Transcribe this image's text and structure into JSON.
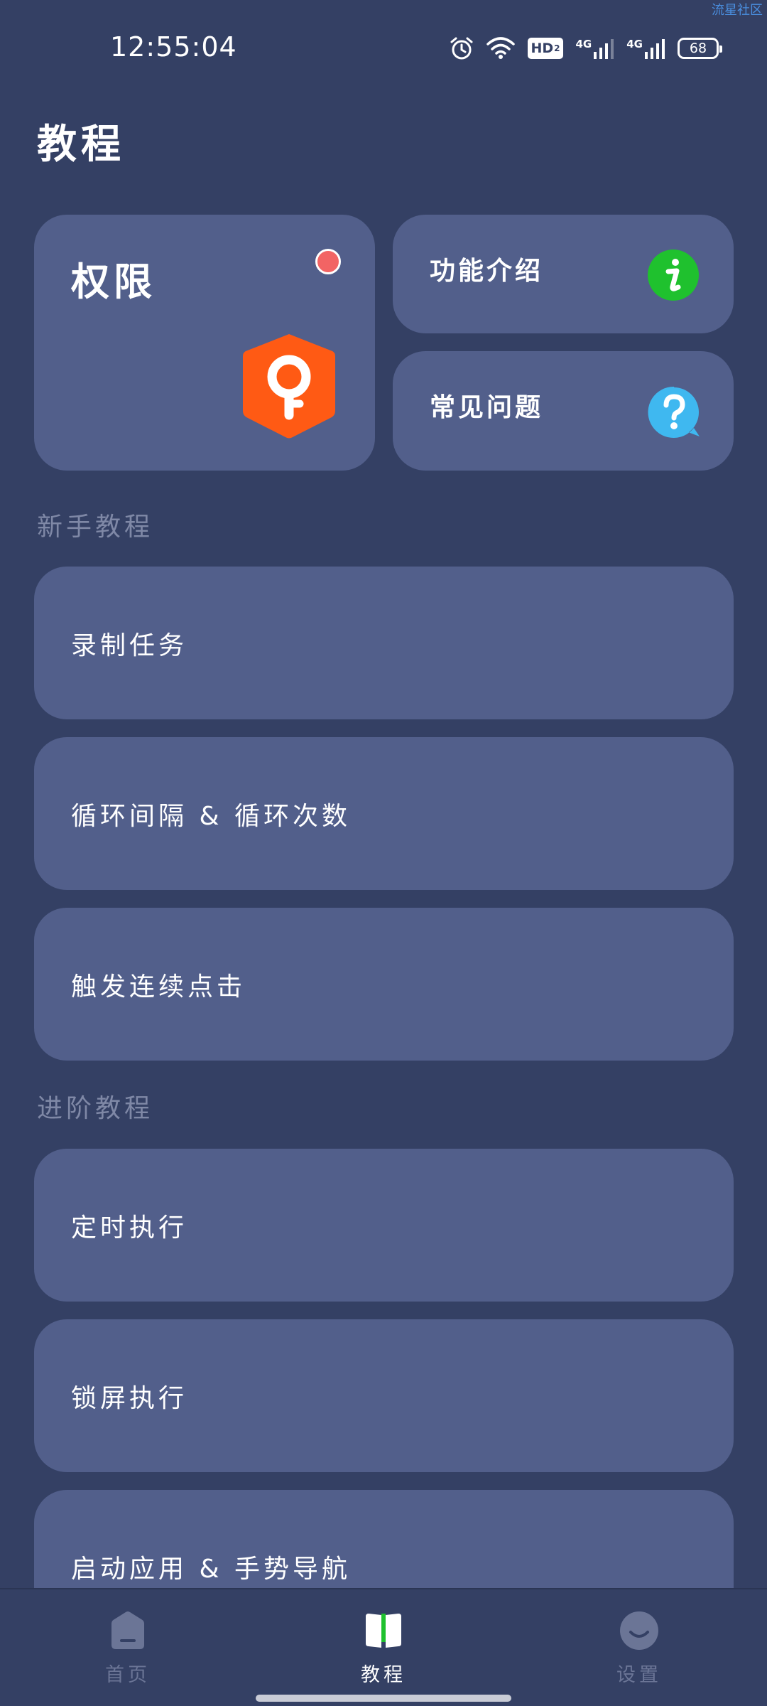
{
  "watermark": "流星社区",
  "status_bar": {
    "time": "12:55:04",
    "hd_label": "HD",
    "hd_sub": "2",
    "network_1": "4G",
    "network_2": "4G",
    "battery": "68",
    "icons": [
      "alarm-icon",
      "wifi-icon",
      "hd-icon",
      "signal-icon",
      "signal-icon",
      "battery-icon"
    ]
  },
  "page_title": "教程",
  "cards": {
    "permission": {
      "label": "权限",
      "icon": "shield-key-icon",
      "dot_color": "#f26464"
    },
    "feature": {
      "label": "功能介绍",
      "icon": "info-icon",
      "icon_color": "#1fc12e"
    },
    "faq": {
      "label": "常见问题",
      "icon": "help-icon",
      "icon_color": "#3fb8f0"
    }
  },
  "sections": {
    "beginner": {
      "title": "新手教程",
      "items": [
        {
          "label": "录制任务"
        },
        {
          "label": "循环间隔 & 循环次数"
        },
        {
          "label": "触发连续点击"
        }
      ]
    },
    "advanced": {
      "title": "进阶教程",
      "items": [
        {
          "label": "定时执行"
        },
        {
          "label": "锁屏执行"
        },
        {
          "label": "启动应用 & 手势导航"
        }
      ]
    }
  },
  "bottom_nav": {
    "items": [
      {
        "label": "首页",
        "icon": "home-icon",
        "active": false
      },
      {
        "label": "教程",
        "icon": "book-icon",
        "active": true
      },
      {
        "label": "设置",
        "icon": "smile-icon",
        "active": false
      }
    ]
  },
  "colors": {
    "background": "#344064",
    "card": "#525f8b",
    "accent_green": "#1fc12e",
    "accent_orange": "#ff5a14"
  }
}
